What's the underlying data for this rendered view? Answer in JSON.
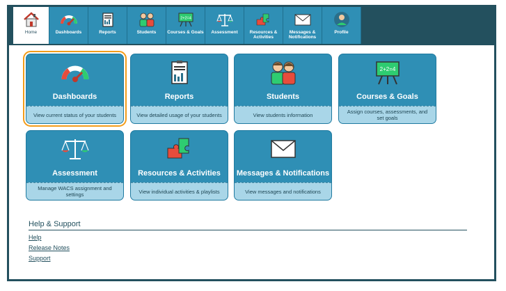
{
  "nav": {
    "tabs": [
      {
        "label": "Home",
        "icon": "home-icon"
      },
      {
        "label": "Dashboards",
        "icon": "gauge-icon"
      },
      {
        "label": "Reports",
        "icon": "report-icon"
      },
      {
        "label": "Students",
        "icon": "students-icon"
      },
      {
        "label": "Courses & Goals",
        "icon": "easel-icon"
      },
      {
        "label": "Assessment",
        "icon": "scales-icon"
      },
      {
        "label": "Resources & Activities",
        "icon": "puzzle-icon"
      },
      {
        "label": "Messages & Notifications",
        "icon": "envelope-icon"
      },
      {
        "label": "Profile",
        "icon": "profile-icon"
      }
    ]
  },
  "tiles": [
    {
      "title": "Dashboards",
      "desc": "View current status of your students",
      "icon": "gauge-icon"
    },
    {
      "title": "Reports",
      "desc": "View detailed usage of your students",
      "icon": "report-icon"
    },
    {
      "title": "Students",
      "desc": "View students information",
      "icon": "students-icon"
    },
    {
      "title": "Courses & Goals",
      "desc": "Assign courses, assessments, and set goals",
      "icon": "easel-icon"
    },
    {
      "title": "Assessment",
      "desc": "Manage WACS assignment and settings",
      "icon": "scales-icon"
    },
    {
      "title": "Resources & Activities",
      "desc": "View individual activities & playlists",
      "icon": "puzzle-icon"
    },
    {
      "title": "Messages & Notifications",
      "desc": "View messages and notifications",
      "icon": "envelope-icon"
    }
  ],
  "easel_text": "2+2=4",
  "help": {
    "title": "Help & Support",
    "links": [
      "Help",
      "Release Notes",
      "Support"
    ]
  },
  "colors": {
    "accent": "#2f8fb5",
    "dark": "#23505e",
    "desc_bg": "#a9d6e8",
    "selected": "#f39c1a"
  }
}
